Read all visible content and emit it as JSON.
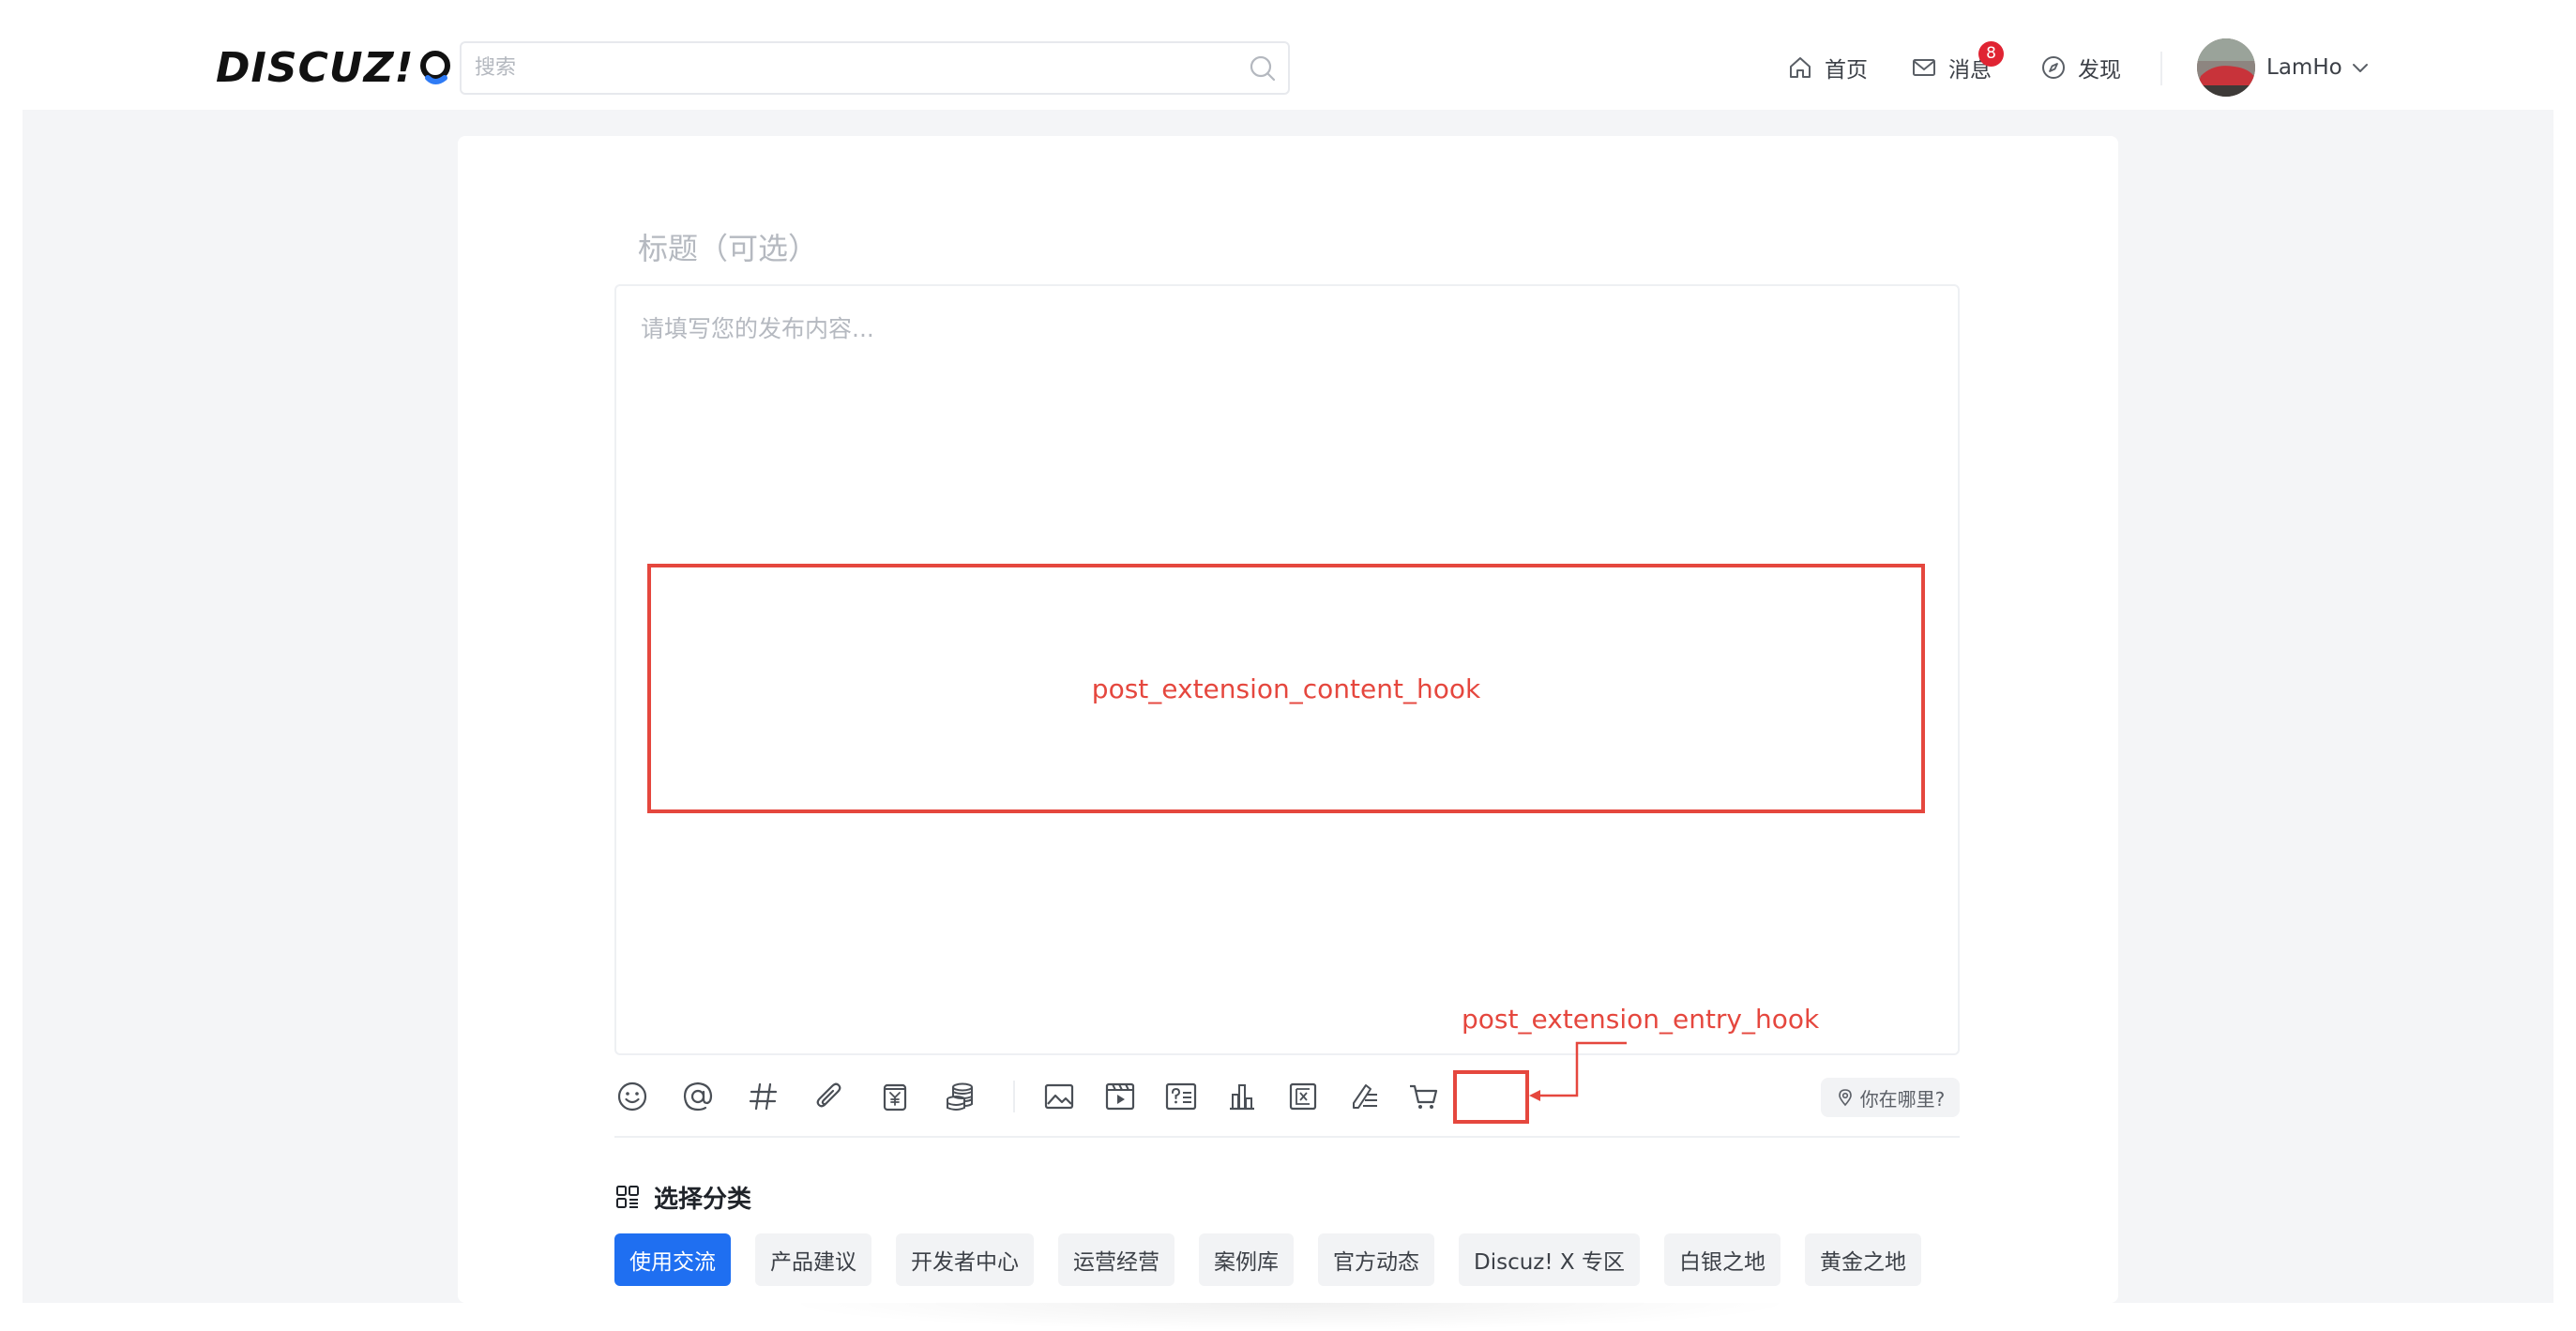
{
  "header": {
    "logo_text": "DISCUZ!",
    "search": {
      "placeholder": "搜索",
      "value": ""
    },
    "nav": [
      {
        "label": "首页",
        "icon": "home-icon"
      },
      {
        "label": "消息",
        "icon": "mail-icon",
        "badge": "8"
      },
      {
        "label": "发现",
        "icon": "compass-icon"
      }
    ],
    "user": {
      "name": "LamHo",
      "icon": "chevron-down-icon"
    }
  },
  "composer": {
    "title_placeholder": "标题（可选）",
    "content_placeholder": "请填写您的发布内容...",
    "content_hook_label": "post_extension_content_hook",
    "entry_hook_label": "post_extension_entry_hook",
    "toolbar": [
      "emoji-icon",
      "mention-icon",
      "topic-hash-icon",
      "attachment-icon",
      "reward-icon",
      "coins-icon",
      "image-icon",
      "video-icon",
      "question-icon",
      "vote-chart-icon",
      "anonymous-icon",
      "rich-text-icon",
      "goods-cart-icon"
    ],
    "location_label": "你在哪里?"
  },
  "categories": {
    "heading": "选择分类",
    "items": [
      "使用交流",
      "产品建议",
      "开发者中心",
      "运营经营",
      "案例库",
      "官方动态",
      "Discuz! X 专区",
      "白银之地",
      "黄金之地"
    ],
    "active_index": 0
  },
  "colors": {
    "accent": "#1f6ff1",
    "hook_red": "#e5473e",
    "badge_red": "#e02433",
    "page_bg": "#f4f5f7"
  }
}
